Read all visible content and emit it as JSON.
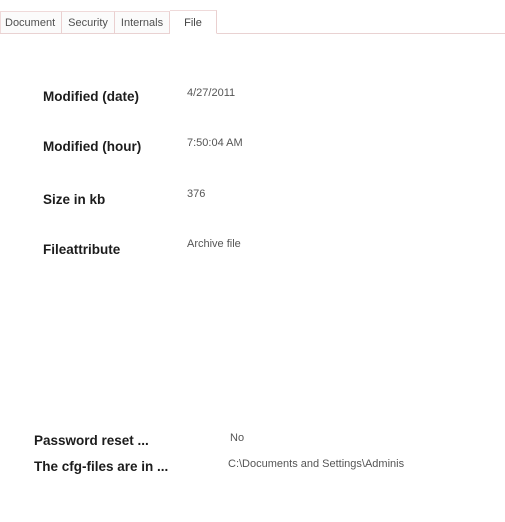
{
  "tabs": [
    {
      "label": "Document"
    },
    {
      "label": "Security"
    },
    {
      "label": "Internals"
    },
    {
      "label": "File"
    }
  ],
  "active_tab": "File",
  "file_props": {
    "modified_date": {
      "label": "Modified (date)",
      "value": "4/27/2011"
    },
    "modified_hour": {
      "label": "Modified (hour)",
      "value": "7:50:04 AM"
    },
    "size_kb": {
      "label": "Size in kb",
      "value": "376"
    },
    "file_attribute": {
      "label": "Fileattribute",
      "value": "Archive file"
    }
  },
  "settings": {
    "password_reset": {
      "label": "Password reset ...",
      "value": "No"
    },
    "cfg_files": {
      "label": "The cfg-files are in ...",
      "value": "C:\\Documents and Settings\\Adminis"
    }
  }
}
